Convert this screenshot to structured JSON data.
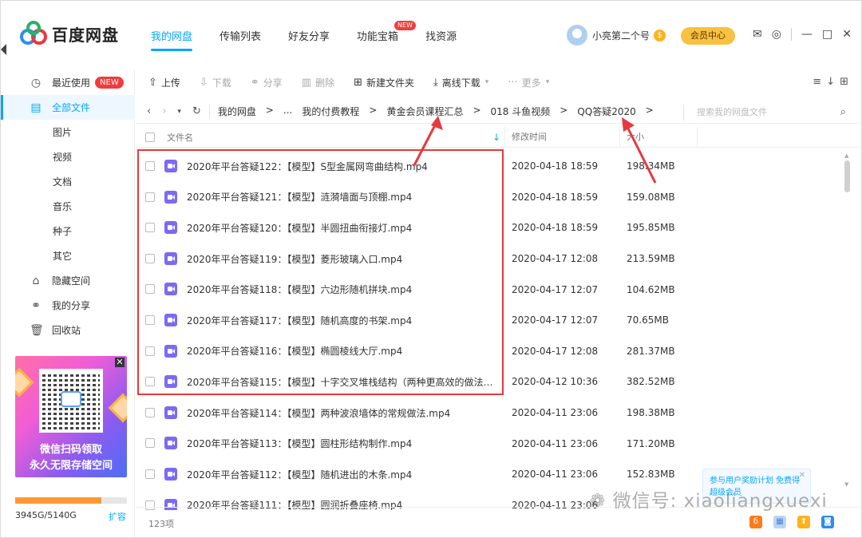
{
  "app": {
    "name": "百度网盘"
  },
  "nav": {
    "tabs": [
      {
        "label": "我的网盘",
        "active": true
      },
      {
        "label": "传输列表"
      },
      {
        "label": "好友分享"
      },
      {
        "label": "功能宝箱",
        "badge": "NEW"
      },
      {
        "label": "找资源"
      }
    ]
  },
  "user": {
    "name": "小亮第二个号",
    "coin_glyph": "$",
    "vip_label": "会员中心"
  },
  "sidebar": {
    "items": [
      {
        "label": "最近使用",
        "badge": "NEW"
      },
      {
        "label": "全部文件",
        "active": true
      },
      {
        "label": "图片"
      },
      {
        "label": "视频"
      },
      {
        "label": "文档"
      },
      {
        "label": "音乐"
      },
      {
        "label": "种子"
      },
      {
        "label": "其它"
      },
      {
        "label": "隐藏空间"
      },
      {
        "label": "我的分享"
      },
      {
        "label": "回收站"
      }
    ],
    "promo": {
      "line1": "微信扫码领取",
      "line2": "永久无限存储空间"
    },
    "quota": {
      "text": "3945G/5140G",
      "used_fraction": 0.77,
      "expand_label": "扩容"
    }
  },
  "toolbar": {
    "upload": "上传",
    "download": "下载",
    "share": "分享",
    "delete": "删除",
    "new_folder": "新建文件夹",
    "offline": "离线下载",
    "more": "更多"
  },
  "breadcrumb": {
    "items": [
      "我的网盘",
      ">",
      "...",
      "我的付费教程",
      ">",
      "黄金会员课程汇总",
      ">",
      "018 斗鱼视频",
      ">",
      "QQ答疑2020",
      ">"
    ],
    "search_placeholder": "搜索我的网盘文件"
  },
  "table": {
    "headers": {
      "name": "文件名",
      "time": "修改时间",
      "size": "大小"
    },
    "rows": [
      {
        "name": "2020年平台答疑122：【模型】S型金属网弯曲结构.mp4",
        "time": "2020-04-18 18:59",
        "size": "198.34MB"
      },
      {
        "name": "2020年平台答疑121：【模型】涟漪墙面与顶棚.mp4",
        "time": "2020-04-18 18:59",
        "size": "159.08MB"
      },
      {
        "name": "2020年平台答疑120：【模型】半圆扭曲衔接灯.mp4",
        "time": "2020-04-18 18:59",
        "size": "195.85MB"
      },
      {
        "name": "2020年平台答疑119：【模型】菱形玻璃入口.mp4",
        "time": "2020-04-17 12:08",
        "size": "213.59MB"
      },
      {
        "name": "2020年平台答疑118：【模型】六边形随机拼块.mp4",
        "time": "2020-04-17 12:07",
        "size": "104.62MB"
      },
      {
        "name": "2020年平台答疑117：【模型】随机高度的书架.mp4",
        "time": "2020-04-17 12:07",
        "size": "70.65MB"
      },
      {
        "name": "2020年平台答疑116：【模型】椭圆棱线大厅.mp4",
        "time": "2020-04-17 12:08",
        "size": "281.37MB"
      },
      {
        "name": "2020年平台答疑115：【模型】十字交叉堆栈结构（两种更高效的做法）...",
        "time": "2020-04-12 10:36",
        "size": "382.52MB"
      },
      {
        "name": "2020年平台答疑114：【模型】两种波浪墙体的常规做法.mp4",
        "time": "2020-04-11 23:06",
        "size": "198.38MB"
      },
      {
        "name": "2020年平台答疑113：【模型】圆柱形结构制作.mp4",
        "time": "2020-04-11 23:06",
        "size": "171.20MB"
      },
      {
        "name": "2020年平台答疑112：【模型】随机进出的木条.mp4",
        "time": "2020-04-11 23:06",
        "size": "152.83MB"
      },
      {
        "name": "2020年平台答疑111：【模型】圆润折叠座椅.mp4",
        "time": "2020-04-11 23:06",
        "size": ""
      }
    ]
  },
  "status": {
    "count": "123项"
  },
  "tooltip": {
    "text": "参与用户奖励计划 免费得超级会员"
  },
  "watermark": {
    "text": "微信号: xiaoliangxuexi"
  }
}
